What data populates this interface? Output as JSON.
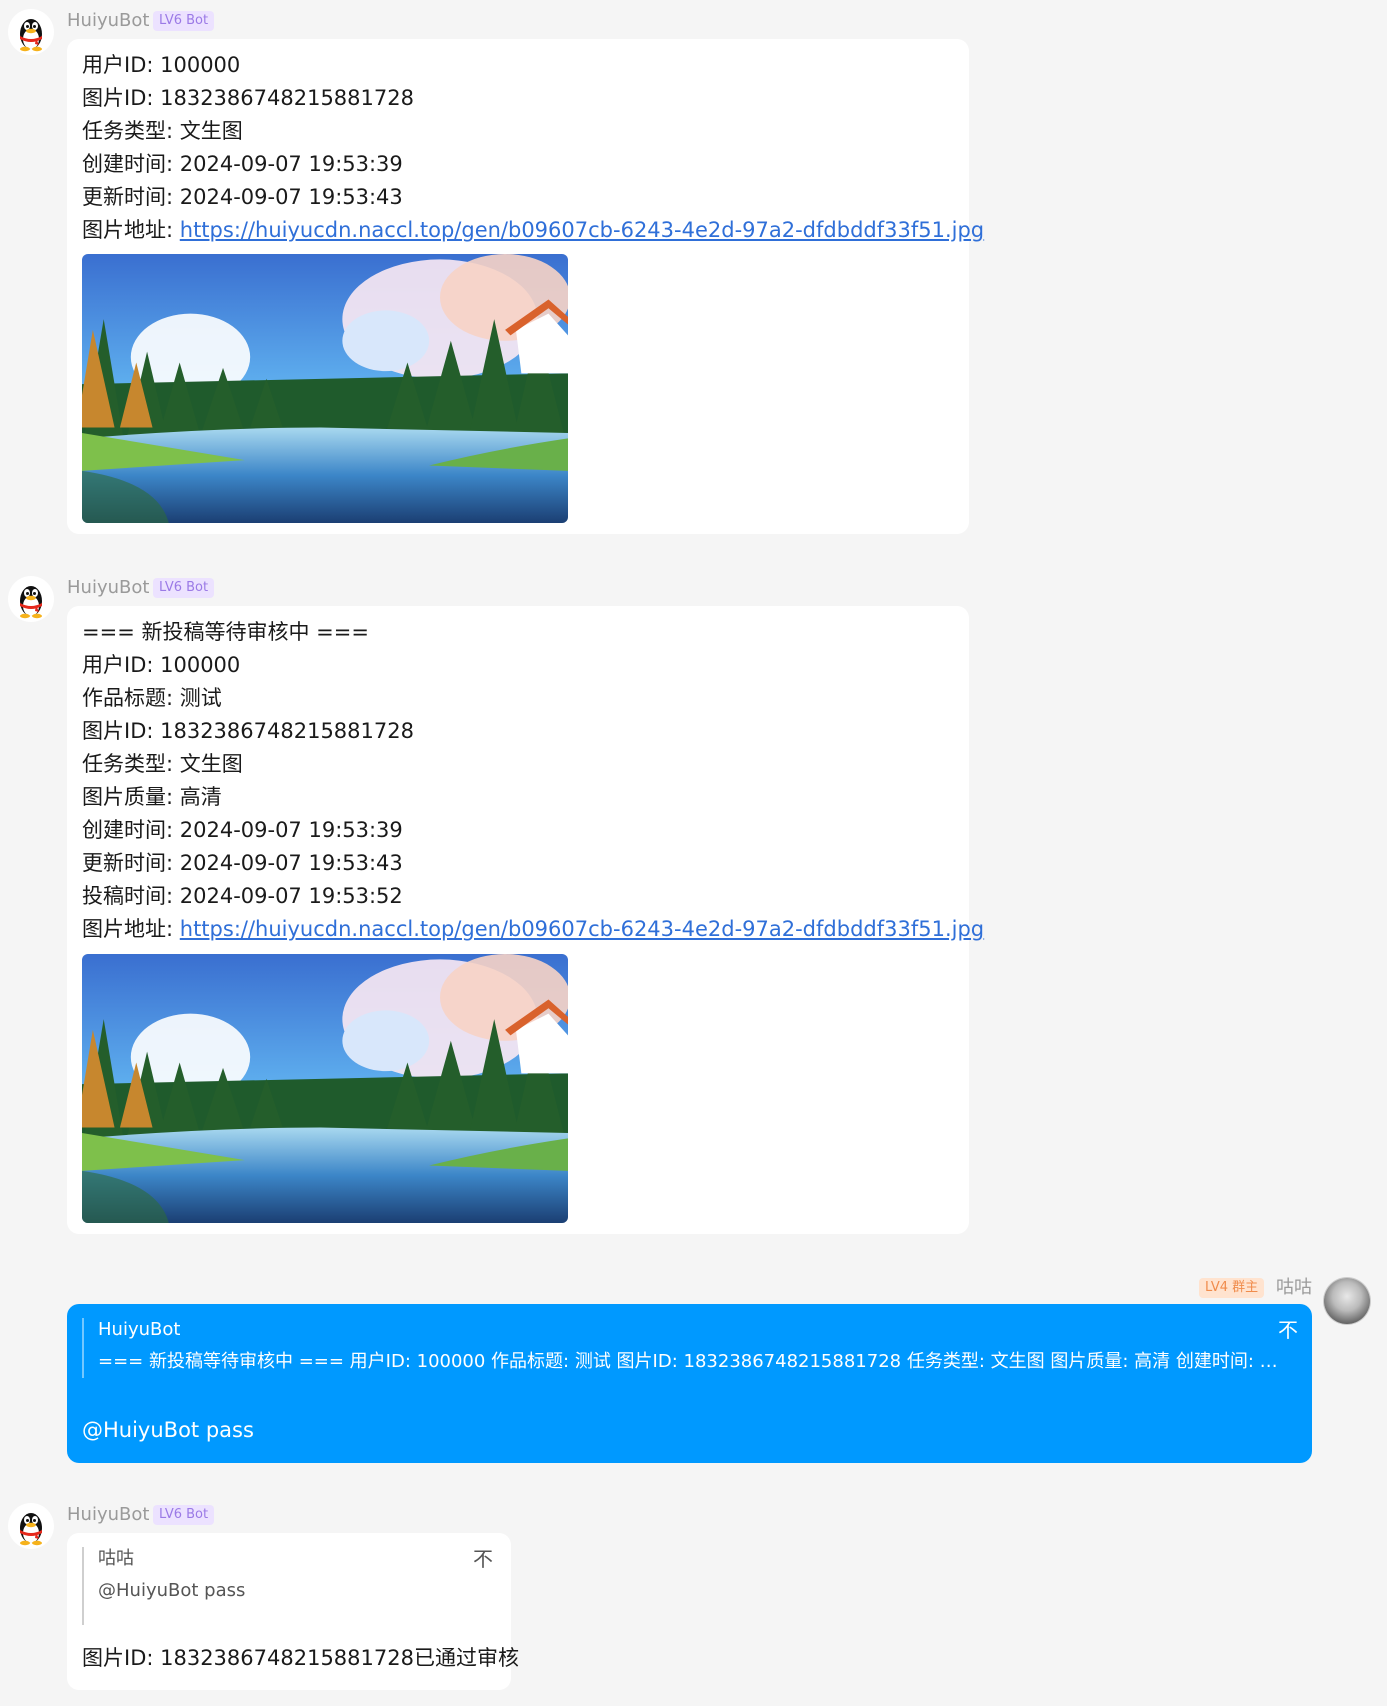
{
  "messages": [
    {
      "sender": "HuiyuBot",
      "badge": "LV6 Bot",
      "lines": [
        "用户ID: 100000",
        "图片ID: 1832386748215881728",
        "任务类型: 文生图",
        "创建时间: 2024-09-07 19:53:39",
        "更新时间: 2024-09-07 19:53:43"
      ],
      "url_label": "图片地址: ",
      "url": "https://huiyucdn.naccl.top/gen/b09607cb-6243-4e2d-97a2-dfdbddf33f51.jpg"
    },
    {
      "sender": "HuiyuBot",
      "badge": "LV6 Bot",
      "lines": [
        "=== 新投稿等待审核中 ===",
        "用户ID: 100000",
        "作品标题: 测试",
        "图片ID: 1832386748215881728",
        "任务类型: 文生图",
        "图片质量: 高清",
        "创建时间: 2024-09-07 19:53:39",
        "更新时间: 2024-09-07 19:53:43",
        "投稿时间: 2024-09-07 19:53:52"
      ],
      "url_label": "图片地址: ",
      "url": "https://huiyucdn.naccl.top/gen/b09607cb-6243-4e2d-97a2-dfdbddf33f51.jpg"
    },
    {
      "sender": "咕咕",
      "badge": "LV4 群主",
      "quote_name": "HuiyuBot",
      "quote_text": "=== 新投稿等待审核中 === 用户ID: 100000 作品标题: 测试 图片ID: 1832386748215881728 任务类型: 文生图 图片质量: 高清 创建时间: 2024-...",
      "quote_icon": "不",
      "text": "@HuiyuBot pass"
    },
    {
      "sender": "HuiyuBot",
      "badge": "LV6 Bot",
      "quote_name": "咕咕",
      "quote_text": "@HuiyuBot pass",
      "quote_icon": "不",
      "text": "图片ID: 1832386748215881728已通过审核"
    }
  ],
  "colors": {
    "background": "#f5f5f5",
    "bubble": "#ffffff",
    "self_bubble": "#0099ff",
    "link": "#2f6fd8",
    "bot_badge_bg": "#ece2ff",
    "owner_badge_bg": "#ffe3cf"
  },
  "icons": {
    "bot_avatar": "qq-penguin-icon",
    "user_avatar": "user-avatar-image",
    "quote_jump": "jump-to-quote-icon"
  }
}
